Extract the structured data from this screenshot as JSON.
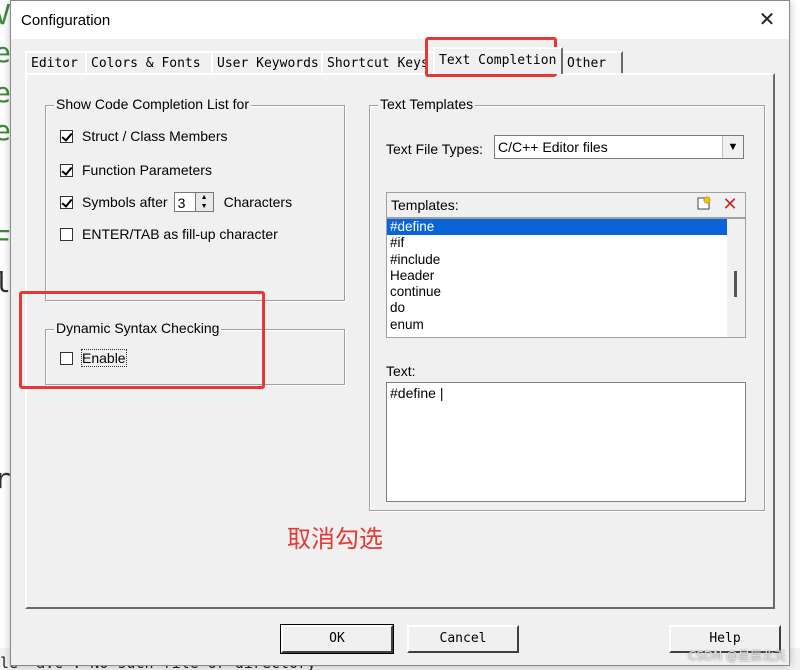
{
  "background": {
    "side_glyphs": [
      "V",
      "e",
      "e",
      "e",
      "F",
      "l",
      "r"
    ],
    "terminal_line": "le \"a.c\": No such file or directory",
    "watermark": "CSDN @星辰北天"
  },
  "dialog": {
    "title": "Configuration",
    "close_label": "✕"
  },
  "tabs": [
    {
      "label": "Editor"
    },
    {
      "label": "Colors & Fonts"
    },
    {
      "label": "User Keywords"
    },
    {
      "label": "Shortcut Keys"
    },
    {
      "label": "Text Completion"
    },
    {
      "label": "Other"
    }
  ],
  "active_tab": "Text Completion",
  "completion_group": {
    "legend": "Show Code Completion List for",
    "struct_label": "Struct / Class Members",
    "struct_checked": true,
    "function_label": "Function Parameters",
    "function_checked": true,
    "symbols_label": "Symbols after",
    "symbols_checked": true,
    "symbols_value": "3",
    "characters_label": "Characters",
    "enter_tab_label": "ENTER/TAB as fill-up character",
    "enter_tab_checked": false
  },
  "syntax_group": {
    "legend": "Dynamic Syntax Checking",
    "enable_label": "Enable",
    "enable_checked": false
  },
  "templates_group": {
    "legend": "Text Templates",
    "file_types_label": "Text File Types:",
    "file_types_value": "C/C++ Editor files",
    "templates_label": "Templates:",
    "items": [
      "#define",
      "#if",
      "#include",
      "Header",
      "continue",
      "do",
      "enum"
    ],
    "selected_item": "#define",
    "text_label": "Text:",
    "text_value": "#define |"
  },
  "buttons": {
    "ok": "OK",
    "cancel": "Cancel",
    "help": "Help"
  },
  "annotation": {
    "text": "取消勾选",
    "color": "#e53935"
  }
}
